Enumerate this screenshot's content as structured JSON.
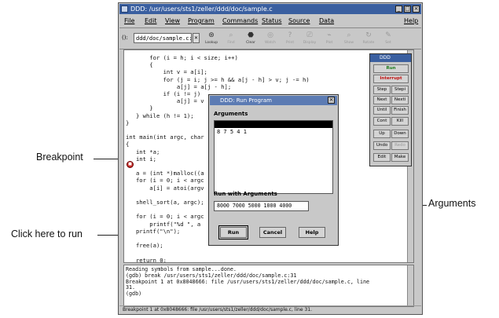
{
  "window": {
    "title": "DDD: /usr/users/sts1/zeller/ddd/doc/sample.c",
    "controls": [
      "_",
      "□",
      "×"
    ]
  },
  "menu": [
    "File",
    "Edit",
    "View",
    "Program",
    "Commands",
    "Status",
    "Source",
    "Data",
    "Help"
  ],
  "toolbar": {
    "arg_label": "():",
    "arg_value": "ddd/doc/sample.c:3(",
    "buttons": [
      {
        "icon": "lookup-icon",
        "glyph": "⊛",
        "label": "Lookup"
      },
      {
        "icon": "find-icon",
        "glyph": "⌕",
        "label": "Find"
      },
      {
        "icon": "break-icon",
        "glyph": "⬣",
        "label": "Clear"
      },
      {
        "icon": "watch-icon",
        "glyph": "◎",
        "label": "Watch"
      },
      {
        "icon": "print-icon",
        "glyph": "?",
        "label": "Print"
      },
      {
        "icon": "display-icon",
        "glyph": "⎚",
        "label": "Display"
      },
      {
        "icon": "plot-icon",
        "glyph": "⌁",
        "label": "Plot"
      },
      {
        "icon": "show-icon",
        "glyph": "⌕",
        "label": "Show"
      },
      {
        "icon": "rotate-icon",
        "glyph": "↻",
        "label": "Rotate"
      },
      {
        "icon": "set-icon",
        "glyph": "✎",
        "label": "Set"
      }
    ]
  },
  "source_code": "       for (i = h; i < size; i++)\n       {\n           int v = a[i];\n           for (j = i; j >= h && a[j - h] > v; j -= h)\n               a[j] = a[j - h];\n           if (i != j)\n               a[j] = v\n       }\n   } while (h != 1);\n}\n\nint main(int argc, char\n{\n   int *a;\n   int i;\n\n   a = (int *)malloc((a\n   for (i = 0; i < argc\n       a[i] = atoi(argv\n\n   shell_sort(a, argc);\n\n   for (i = 0; i < argc\n       printf(\"%d \", a\n   printf(\"\\n\");\n\n   free(a);\n\n   return 0;\n}",
  "console_text": "Reading symbols from sample...done.\n(gdb) break /usr/users/sts1/zeller/ddd/doc/sample.c:31\nBreakpoint 1 at 0x8048666: file /usr/users/sts1/zeller/ddd/doc/sample.c, line\n31.\n(gdb) ",
  "status": "Breakpoint 1 at 0x8048666: file /usr/users/sts1/zeller/ddd/doc/sample.c, line 31.",
  "command_tool": {
    "title": "DDD",
    "run": "Run",
    "interrupt": "Interrupt",
    "rows": [
      [
        "Step",
        "Stepi"
      ],
      [
        "Next",
        "Nexti"
      ],
      [
        "Until",
        "Finish"
      ],
      [
        "Cont",
        "Kill"
      ],
      [
        "Up",
        "Down"
      ],
      [
        "Undo",
        "Redo"
      ],
      [
        "Edit",
        "Make"
      ]
    ]
  },
  "dialog": {
    "title": "DDD: Run Program",
    "arguments_label": "Arguments",
    "history": [
      "8 7 5 4 1"
    ],
    "run_with_label": "Run with Arguments",
    "run_with_value": "8000 7000 5000 1000 4000",
    "run_button": "Run",
    "cancel_button": "Cancel",
    "help_button": "Help"
  },
  "annotations": {
    "breakpoint": "Breakpoint",
    "arguments": "Arguments",
    "click_to_run": "Click here to run"
  },
  "colors": {
    "titlebar": "#3a5fa0",
    "breakpoint": "#c9302c",
    "run_text": "#1a7a1a",
    "interrupt_text": "#c01010"
  }
}
